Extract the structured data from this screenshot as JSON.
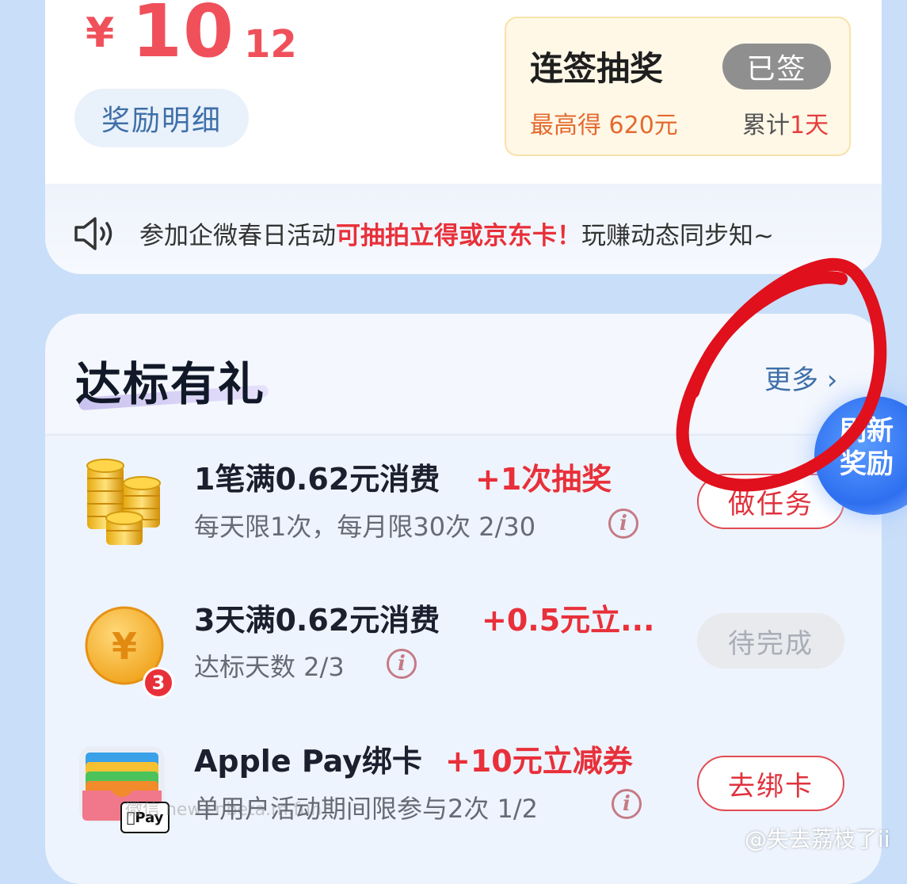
{
  "balance": {
    "currency_symbol": "¥",
    "integer_part": "10",
    "decimal_sep": ".",
    "decimal_part": "12",
    "detail_button": "奖励明细"
  },
  "lottery": {
    "title": "连签抽奖",
    "status_button": "已签",
    "max_prefix": "最高得",
    "max_value": "620元",
    "cumulative_prefix": "累计",
    "cumulative_value": "1天"
  },
  "notice": {
    "prefix": "参加企微春日活动",
    "highlight": "可抽拍立得或京东卡！",
    "suffix": "玩赚动态同步知~"
  },
  "section": {
    "title": "达标有礼",
    "more_label": "更多 ›"
  },
  "refresh_bubble": {
    "line1": "刷新",
    "line2": "奖励"
  },
  "tasks": [
    {
      "title": "1笔满0.62元消费",
      "reward": "+1次抽奖",
      "subtitle": "每天限1次，每月限30次 2/30",
      "info_glyph": "i",
      "button": "做任务"
    },
    {
      "title": "3天满0.62元消费",
      "reward": "+0.5元立...",
      "subtitle": "达标天数 2/3",
      "info_glyph": "i",
      "badge": "3",
      "button": "待完成"
    },
    {
      "title": "Apple Pay绑卡",
      "reward": "+10元立减券",
      "subtitle": "单用户活动期间限参与2次 1/2",
      "info_glyph": "i",
      "logo_text": "Pay",
      "button": "去绑卡"
    }
  ],
  "watermark": "@失去荔枝了ii",
  "watermark_faint": "微信 new.cnbeta.m.fun",
  "colors": {
    "accent_red": "#e8303a",
    "link_blue": "#3e6fa8",
    "lottery_bg": "#fff8e7",
    "page_bg": "#c9def8",
    "annotation_red": "#e0101c"
  }
}
